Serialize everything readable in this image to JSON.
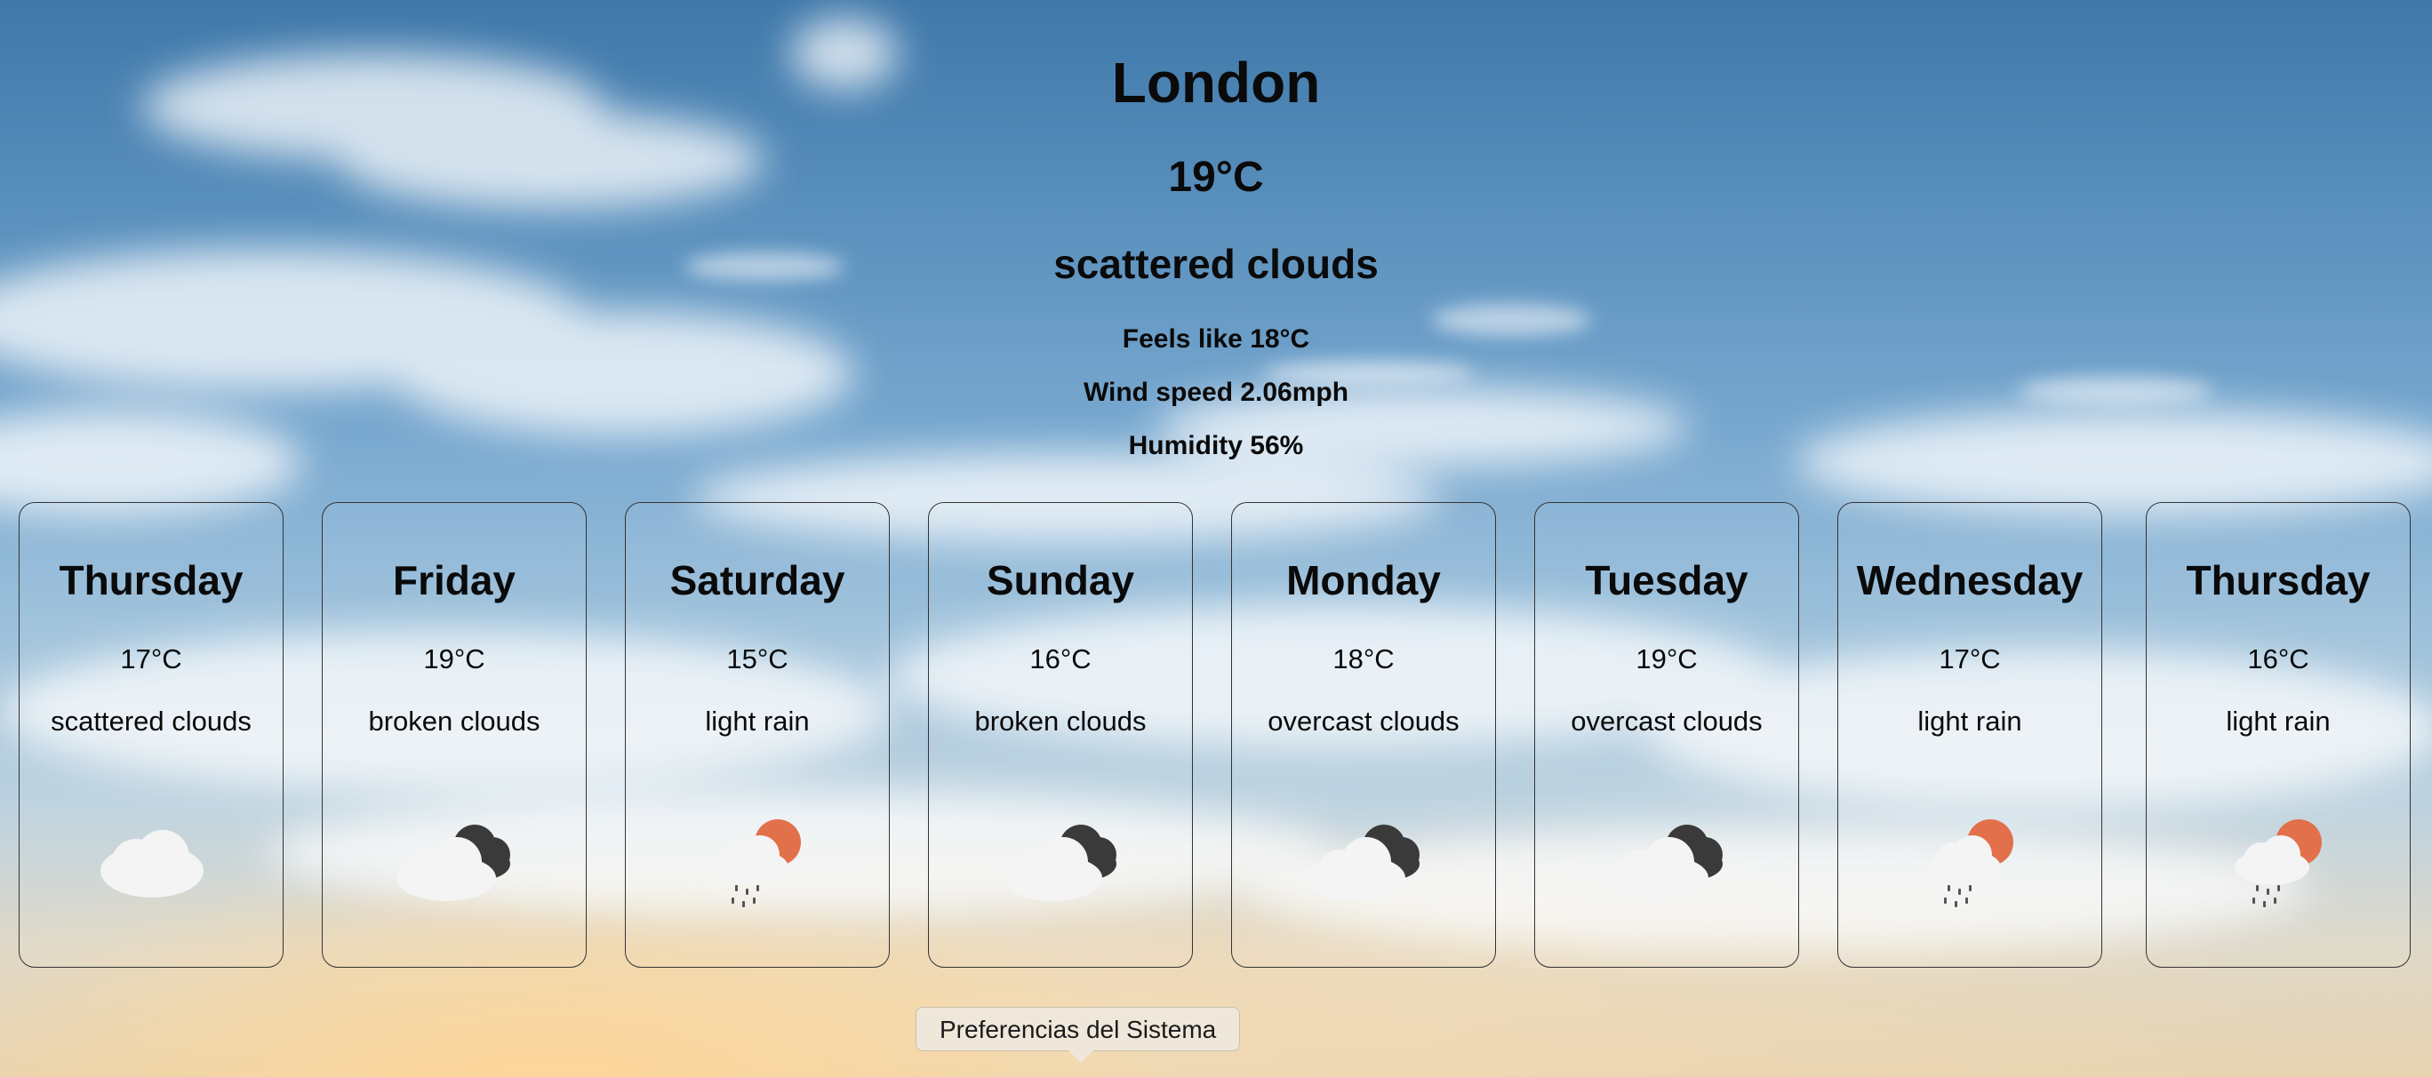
{
  "current": {
    "city": "London",
    "temperature": "19°C",
    "description": "scattered clouds",
    "feels_like": "Feels like 18°C",
    "wind_speed": "Wind speed 2.06mph",
    "humidity": "Humidity 56%"
  },
  "forecast": [
    {
      "day": "Thursday",
      "temp": "17°C",
      "desc": "scattered clouds",
      "icon": "cloud-icon"
    },
    {
      "day": "Friday",
      "temp": "19°C",
      "desc": "broken clouds",
      "icon": "broken-clouds-icon"
    },
    {
      "day": "Saturday",
      "temp": "15°C",
      "desc": "light rain",
      "icon": "rain-sun-icon"
    },
    {
      "day": "Sunday",
      "temp": "16°C",
      "desc": "broken clouds",
      "icon": "broken-clouds-icon"
    },
    {
      "day": "Monday",
      "temp": "18°C",
      "desc": "overcast clouds",
      "icon": "broken-clouds-icon"
    },
    {
      "day": "Tuesday",
      "temp": "19°C",
      "desc": "overcast clouds",
      "icon": "broken-clouds-icon"
    },
    {
      "day": "Wednesday",
      "temp": "17°C",
      "desc": "light rain",
      "icon": "rain-sun-icon"
    },
    {
      "day": "Thursday",
      "temp": "16°C",
      "desc": "light rain",
      "icon": "rain-sun-icon"
    }
  ],
  "tooltip": {
    "label": "Preferencias del Sistema"
  },
  "colors": {
    "sun": "#e2704a",
    "dark_cloud": "#3a3a3a",
    "light_cloud": "#f4f4f4"
  }
}
